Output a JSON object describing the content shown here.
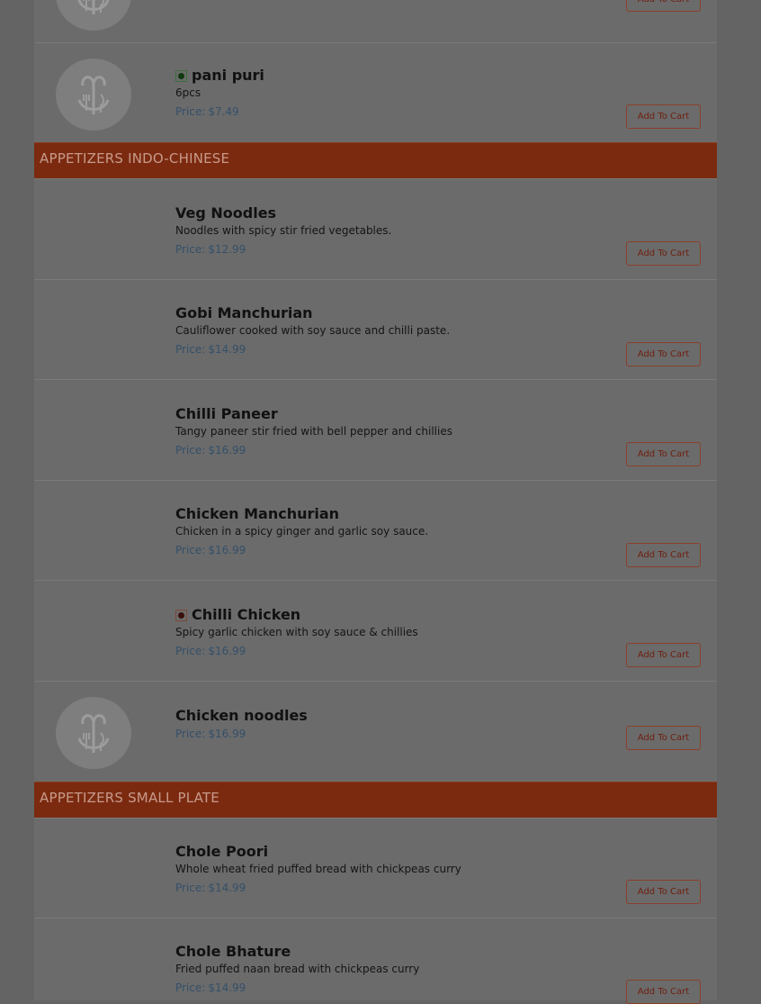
{
  "cart_label": "Add To Cart",
  "price_label": "Price:",
  "top_partial": {
    "cart_label": "Add To Cart"
  },
  "pani_puri": {
    "name": "pani puri",
    "desc": "6pcs",
    "price": "$7.49"
  },
  "sections": [
    {
      "title": "APPETIZERS INDO-CHINESE"
    },
    {
      "title": "APPETIZERS SMALL PLATE"
    }
  ],
  "indo_chinese": [
    {
      "name": "Veg Noodles",
      "desc": "Noodles with spicy stir fried vegetables.",
      "price": "$12.99"
    },
    {
      "name": "Gobi Manchurian",
      "desc": "Cauliflower cooked with soy sauce and chilli paste.",
      "price": "$14.99"
    },
    {
      "name": "Chilli Paneer",
      "desc": "Tangy paneer stir fried with bell pepper and chillies",
      "price": "$16.99"
    },
    {
      "name": "Chicken Manchurian",
      "desc": "Chicken in a spicy ginger and garlic soy sauce.",
      "price": "$16.99"
    },
    {
      "name": "Chilli Chicken",
      "desc": "Spicy garlic chicken with soy sauce & chillies",
      "price": "$16.99"
    },
    {
      "name": "Chicken noodles",
      "price": "$16.99"
    }
  ],
  "small_plate": [
    {
      "name": "Chole Poori",
      "desc": "Whole wheat fried puffed bread with chickpeas curry",
      "price": "$14.99"
    },
    {
      "name": "Chole Bhature",
      "desc": "Fried puffed naan bread with chickpeas curry",
      "price": "$14.99"
    }
  ],
  "icons": {
    "thumb": "restaurant-placeholder-icon",
    "veg": "veg-indicator-icon",
    "nonveg": "non-veg-indicator-icon"
  },
  "colors": {
    "overlay": "#646464",
    "category_bar": "#7b2a10",
    "price": "#34506a"
  }
}
